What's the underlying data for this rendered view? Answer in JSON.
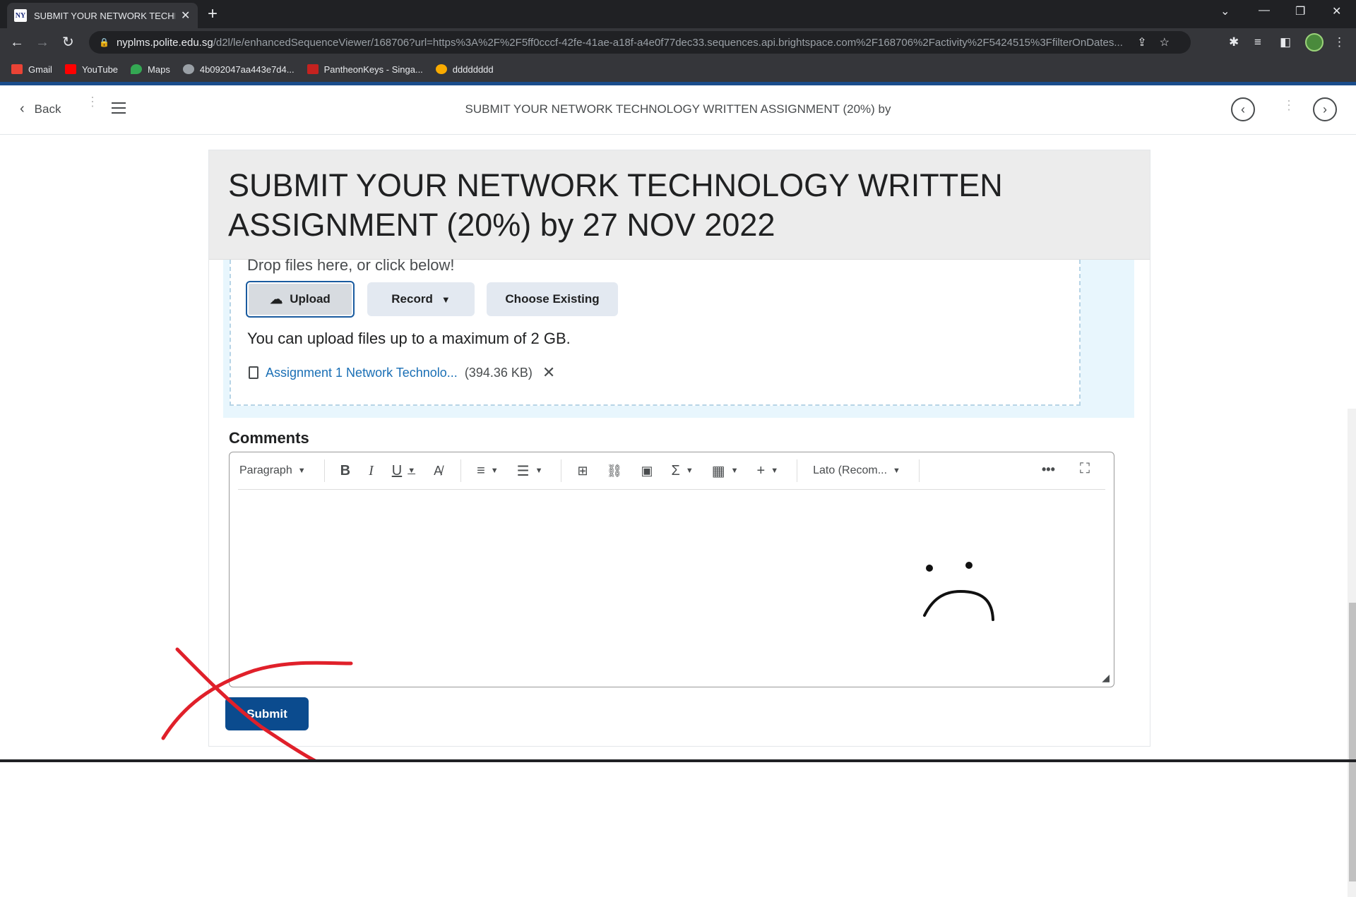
{
  "browser": {
    "tab_title": "SUBMIT YOUR NETWORK TECHNOL",
    "url_domain": "nyplms.polite.edu.sg",
    "url_path": "/d2l/le/enhancedSequenceViewer/168706?url=https%3A%2F%2F5ff0cccf-42fe-41ae-a18f-a4e0f77dec33.sequences.api.brightspace.com%2F168706%2Factivity%2F5424515%3FfilterOnDates...",
    "bookmarks": [
      {
        "label": "Gmail",
        "color": "#ea4335"
      },
      {
        "label": "YouTube",
        "color": "#ff0000"
      },
      {
        "label": "Maps",
        "color": "#34a853"
      },
      {
        "label": "4b092047aa443e7d4...",
        "color": "#9aa0a6"
      },
      {
        "label": "PantheonKeys - Singa...",
        "color": "#c5221f"
      },
      {
        "label": "dddddddd",
        "color": "#f9ab00"
      }
    ]
  },
  "header": {
    "back_label": "Back",
    "title": "SUBMIT YOUR NETWORK TECHNOLOGY WRITTEN ASSIGNMENT (20%) by"
  },
  "page": {
    "title": "SUBMIT YOUR NETWORK TECHNOLOGY WRITTEN ASSIGNMENT (20%) by 27 NOV 2022"
  },
  "upload": {
    "drop_text": "Drop files here, or click below!",
    "upload_label": "Upload",
    "record_label": "Record",
    "choose_label": "Choose Existing",
    "limit_text": "You can upload files up to a maximum of 2 GB.",
    "file_name": "Assignment 1 Network Technolo...",
    "file_size": "(394.36 KB)"
  },
  "comments": {
    "label": "Comments",
    "format_label": "Paragraph",
    "font_label": "Lato (Recom..."
  },
  "submit_label": "Submit",
  "annotation_color": "#e0202a"
}
